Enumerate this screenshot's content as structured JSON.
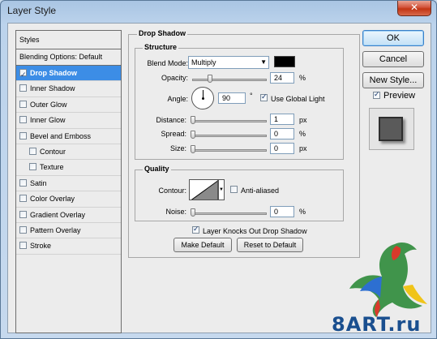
{
  "window": {
    "title": "Layer Style",
    "close_glyph": "✕"
  },
  "styles": {
    "header": "Styles",
    "blending": "Blending Options: Default",
    "items": [
      {
        "label": "Drop Shadow",
        "checked": true,
        "active": true,
        "sub": false
      },
      {
        "label": "Inner Shadow",
        "checked": false,
        "active": false,
        "sub": false
      },
      {
        "label": "Outer Glow",
        "checked": false,
        "active": false,
        "sub": false
      },
      {
        "label": "Inner Glow",
        "checked": false,
        "active": false,
        "sub": false
      },
      {
        "label": "Bevel and Emboss",
        "checked": false,
        "active": false,
        "sub": false
      },
      {
        "label": "Contour",
        "checked": false,
        "active": false,
        "sub": true
      },
      {
        "label": "Texture",
        "checked": false,
        "active": false,
        "sub": true
      },
      {
        "label": "Satin",
        "checked": false,
        "active": false,
        "sub": false
      },
      {
        "label": "Color Overlay",
        "checked": false,
        "active": false,
        "sub": false
      },
      {
        "label": "Gradient Overlay",
        "checked": false,
        "active": false,
        "sub": false
      },
      {
        "label": "Pattern Overlay",
        "checked": false,
        "active": false,
        "sub": false
      },
      {
        "label": "Stroke",
        "checked": false,
        "active": false,
        "sub": false
      }
    ]
  },
  "drop_shadow": {
    "title": "Drop Shadow",
    "structure": {
      "title": "Structure",
      "blend_mode_label": "Blend Mode:",
      "blend_mode_value": "Multiply",
      "shadow_color": "#000000",
      "opacity_label": "Opacity:",
      "opacity_value": "24",
      "opacity_unit": "%",
      "opacity_level": 0.24,
      "angle_label": "Angle:",
      "angle_value": "90",
      "angle_unit": "°",
      "use_global_light_label": "Use Global Light",
      "use_global_light": true,
      "distance_label": "Distance:",
      "distance_value": "1",
      "distance_unit": "px",
      "spread_label": "Spread:",
      "spread_value": "0",
      "spread_unit": "%",
      "size_label": "Size:",
      "size_value": "0",
      "size_unit": "px"
    },
    "quality": {
      "title": "Quality",
      "contour_label": "Contour:",
      "anti_aliased_label": "Anti-aliased",
      "anti_aliased": false,
      "noise_label": "Noise:",
      "noise_value": "0",
      "noise_unit": "%"
    },
    "knockout_label": "Layer Knocks Out Drop Shadow",
    "knockout": true,
    "make_default": "Make Default",
    "reset_default": "Reset to Default"
  },
  "buttons": {
    "ok": "OK",
    "cancel": "Cancel",
    "new_style": "New Style...",
    "preview_label": "Preview",
    "preview_checked": true
  },
  "watermark": {
    "text": "8ART.ru"
  }
}
